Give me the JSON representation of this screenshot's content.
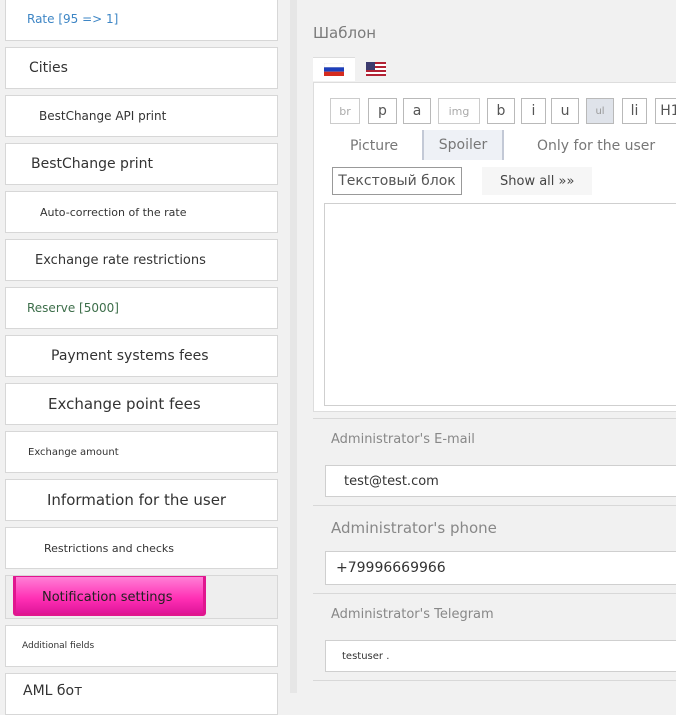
{
  "sidebar": {
    "items": [
      {
        "label": "Rate [95 => 1]"
      },
      {
        "label": "Cities"
      },
      {
        "label": "BestChange API print"
      },
      {
        "label": "BestChange print"
      },
      {
        "label": "Auto-correction of the rate"
      },
      {
        "label": "Exchange rate restrictions"
      },
      {
        "label": "Reserve [5000]"
      },
      {
        "label": "Payment systems fees"
      },
      {
        "label": "Exchange point fees"
      },
      {
        "label": "Exchange amount"
      },
      {
        "label": "Information for the user"
      },
      {
        "label": "Restrictions and checks"
      },
      {
        "label": "Notification settings"
      },
      {
        "label": "Additional fields"
      },
      {
        "label": "AML бот"
      }
    ],
    "active_index": 12,
    "highlight_color": "#ff3fbf"
  },
  "template": {
    "title": "Шаблон",
    "languages": [
      {
        "code": "ru",
        "icon": "russia-flag-icon"
      },
      {
        "code": "en",
        "icon": "usa-flag-icon"
      }
    ],
    "tag_buttons": [
      "br",
      "p",
      "a",
      "img",
      "b",
      "i",
      "u",
      "ul",
      "li",
      "H1"
    ],
    "insert_buttons": [
      "Picture",
      "Spoiler",
      "Only for the user"
    ],
    "text_block_button": "Текстовый блок",
    "show_all": "Show all »»",
    "content": ""
  },
  "fields": {
    "email": {
      "label": "Administrator's E-mail",
      "value": "test@test.com"
    },
    "phone": {
      "label": "Administrator's phone",
      "value": "+79996669966"
    },
    "telegram": {
      "label": "Administrator's Telegram",
      "value": "testuser ."
    }
  }
}
